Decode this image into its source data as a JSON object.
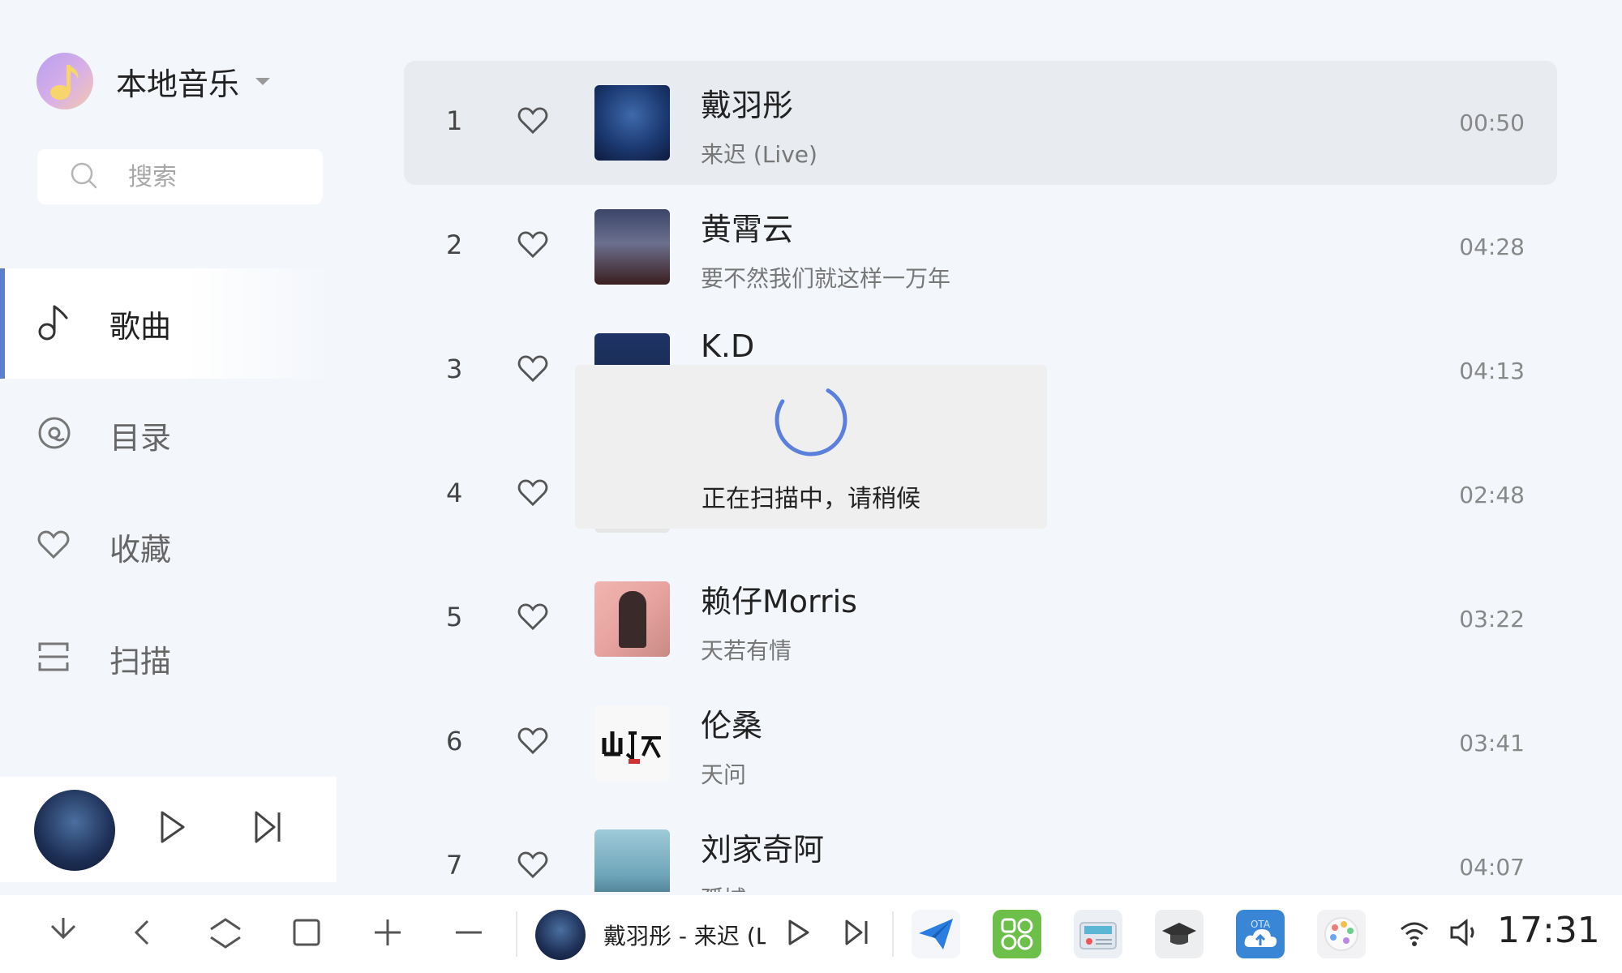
{
  "library": {
    "title": "本地音乐"
  },
  "search": {
    "placeholder": "搜索"
  },
  "nav": [
    {
      "label": "歌曲",
      "icon": "music-note-icon",
      "active": true
    },
    {
      "label": "目录",
      "icon": "folder-disc-icon",
      "active": false
    },
    {
      "label": "收藏",
      "icon": "heart-icon",
      "active": false
    },
    {
      "label": "扫描",
      "icon": "scan-icon",
      "active": false
    }
  ],
  "songs": [
    {
      "num": "1",
      "title": "戴羽彤",
      "subtitle": "来迟 (Live)",
      "duration": "00:50",
      "cover_color": "#1c3a73",
      "active": true
    },
    {
      "num": "2",
      "title": "黄霄云",
      "subtitle": "要不然我们就这样一万年",
      "duration": "04:28",
      "cover_color": "#2a2f4a"
    },
    {
      "num": "3",
      "title": "K.D",
      "subtitle": "",
      "duration": "04:13",
      "cover_color": "#1a2f5a"
    },
    {
      "num": "4",
      "title": "",
      "subtitle": "",
      "duration": "02:48",
      "cover_color": "#e6e6e6"
    },
    {
      "num": "5",
      "title": "赖仔Morris",
      "subtitle": "天若有情",
      "duration": "03:22",
      "cover_color": "#e8a3a0"
    },
    {
      "num": "6",
      "title": "伦桑",
      "subtitle": "天问",
      "duration": "03:41",
      "cover_color": "#f5f5f5"
    },
    {
      "num": "7",
      "title": "刘家奇阿",
      "subtitle": "孤城",
      "duration": "04:07",
      "cover_color": "#7fb1c4"
    }
  ],
  "loading": {
    "text": "正在扫描中，请稍候",
    "accent": "#5b7fdc"
  },
  "now_playing": {
    "text": "戴羽彤 - 来迟 (Live)"
  },
  "taskbar": {
    "clock": "17:31"
  },
  "colors": {
    "accent": "#5b7fcc",
    "active_row": "#e8ebf0",
    "background": "#f3f6fb"
  }
}
